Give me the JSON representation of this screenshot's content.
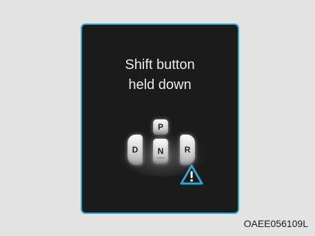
{
  "display": {
    "message_line1": "Shift button",
    "message_line2": "held down"
  },
  "selector": {
    "p_label": "P",
    "n_label": "N",
    "d_label": "D",
    "r_label": "R"
  },
  "icons": {
    "warning": "warning-triangle-icon"
  },
  "colors": {
    "frame_border": "#29a9d6",
    "screen_background": "#1b1b1b",
    "page_background": "#e3e3e3",
    "warning_accent": "#29a9d6"
  },
  "image_code": "OAEE056109L"
}
